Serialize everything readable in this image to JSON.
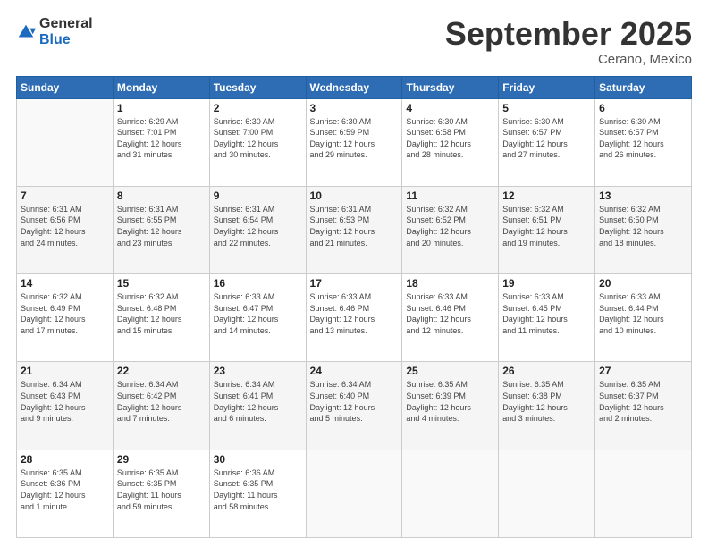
{
  "header": {
    "logo_general": "General",
    "logo_blue": "Blue",
    "month_title": "September 2025",
    "location": "Cerano, Mexico"
  },
  "weekdays": [
    "Sunday",
    "Monday",
    "Tuesday",
    "Wednesday",
    "Thursday",
    "Friday",
    "Saturday"
  ],
  "weeks": [
    [
      {
        "day": "",
        "info": ""
      },
      {
        "day": "1",
        "info": "Sunrise: 6:29 AM\nSunset: 7:01 PM\nDaylight: 12 hours\nand 31 minutes."
      },
      {
        "day": "2",
        "info": "Sunrise: 6:30 AM\nSunset: 7:00 PM\nDaylight: 12 hours\nand 30 minutes."
      },
      {
        "day": "3",
        "info": "Sunrise: 6:30 AM\nSunset: 6:59 PM\nDaylight: 12 hours\nand 29 minutes."
      },
      {
        "day": "4",
        "info": "Sunrise: 6:30 AM\nSunset: 6:58 PM\nDaylight: 12 hours\nand 28 minutes."
      },
      {
        "day": "5",
        "info": "Sunrise: 6:30 AM\nSunset: 6:57 PM\nDaylight: 12 hours\nand 27 minutes."
      },
      {
        "day": "6",
        "info": "Sunrise: 6:30 AM\nSunset: 6:57 PM\nDaylight: 12 hours\nand 26 minutes."
      }
    ],
    [
      {
        "day": "7",
        "info": "Sunrise: 6:31 AM\nSunset: 6:56 PM\nDaylight: 12 hours\nand 24 minutes."
      },
      {
        "day": "8",
        "info": "Sunrise: 6:31 AM\nSunset: 6:55 PM\nDaylight: 12 hours\nand 23 minutes."
      },
      {
        "day": "9",
        "info": "Sunrise: 6:31 AM\nSunset: 6:54 PM\nDaylight: 12 hours\nand 22 minutes."
      },
      {
        "day": "10",
        "info": "Sunrise: 6:31 AM\nSunset: 6:53 PM\nDaylight: 12 hours\nand 21 minutes."
      },
      {
        "day": "11",
        "info": "Sunrise: 6:32 AM\nSunset: 6:52 PM\nDaylight: 12 hours\nand 20 minutes."
      },
      {
        "day": "12",
        "info": "Sunrise: 6:32 AM\nSunset: 6:51 PM\nDaylight: 12 hours\nand 19 minutes."
      },
      {
        "day": "13",
        "info": "Sunrise: 6:32 AM\nSunset: 6:50 PM\nDaylight: 12 hours\nand 18 minutes."
      }
    ],
    [
      {
        "day": "14",
        "info": "Sunrise: 6:32 AM\nSunset: 6:49 PM\nDaylight: 12 hours\nand 17 minutes."
      },
      {
        "day": "15",
        "info": "Sunrise: 6:32 AM\nSunset: 6:48 PM\nDaylight: 12 hours\nand 15 minutes."
      },
      {
        "day": "16",
        "info": "Sunrise: 6:33 AM\nSunset: 6:47 PM\nDaylight: 12 hours\nand 14 minutes."
      },
      {
        "day": "17",
        "info": "Sunrise: 6:33 AM\nSunset: 6:46 PM\nDaylight: 12 hours\nand 13 minutes."
      },
      {
        "day": "18",
        "info": "Sunrise: 6:33 AM\nSunset: 6:46 PM\nDaylight: 12 hours\nand 12 minutes."
      },
      {
        "day": "19",
        "info": "Sunrise: 6:33 AM\nSunset: 6:45 PM\nDaylight: 12 hours\nand 11 minutes."
      },
      {
        "day": "20",
        "info": "Sunrise: 6:33 AM\nSunset: 6:44 PM\nDaylight: 12 hours\nand 10 minutes."
      }
    ],
    [
      {
        "day": "21",
        "info": "Sunrise: 6:34 AM\nSunset: 6:43 PM\nDaylight: 12 hours\nand 9 minutes."
      },
      {
        "day": "22",
        "info": "Sunrise: 6:34 AM\nSunset: 6:42 PM\nDaylight: 12 hours\nand 7 minutes."
      },
      {
        "day": "23",
        "info": "Sunrise: 6:34 AM\nSunset: 6:41 PM\nDaylight: 12 hours\nand 6 minutes."
      },
      {
        "day": "24",
        "info": "Sunrise: 6:34 AM\nSunset: 6:40 PM\nDaylight: 12 hours\nand 5 minutes."
      },
      {
        "day": "25",
        "info": "Sunrise: 6:35 AM\nSunset: 6:39 PM\nDaylight: 12 hours\nand 4 minutes."
      },
      {
        "day": "26",
        "info": "Sunrise: 6:35 AM\nSunset: 6:38 PM\nDaylight: 12 hours\nand 3 minutes."
      },
      {
        "day": "27",
        "info": "Sunrise: 6:35 AM\nSunset: 6:37 PM\nDaylight: 12 hours\nand 2 minutes."
      }
    ],
    [
      {
        "day": "28",
        "info": "Sunrise: 6:35 AM\nSunset: 6:36 PM\nDaylight: 12 hours\nand 1 minute."
      },
      {
        "day": "29",
        "info": "Sunrise: 6:35 AM\nSunset: 6:35 PM\nDaylight: 11 hours\nand 59 minutes."
      },
      {
        "day": "30",
        "info": "Sunrise: 6:36 AM\nSunset: 6:35 PM\nDaylight: 11 hours\nand 58 minutes."
      },
      {
        "day": "",
        "info": ""
      },
      {
        "day": "",
        "info": ""
      },
      {
        "day": "",
        "info": ""
      },
      {
        "day": "",
        "info": ""
      }
    ]
  ]
}
